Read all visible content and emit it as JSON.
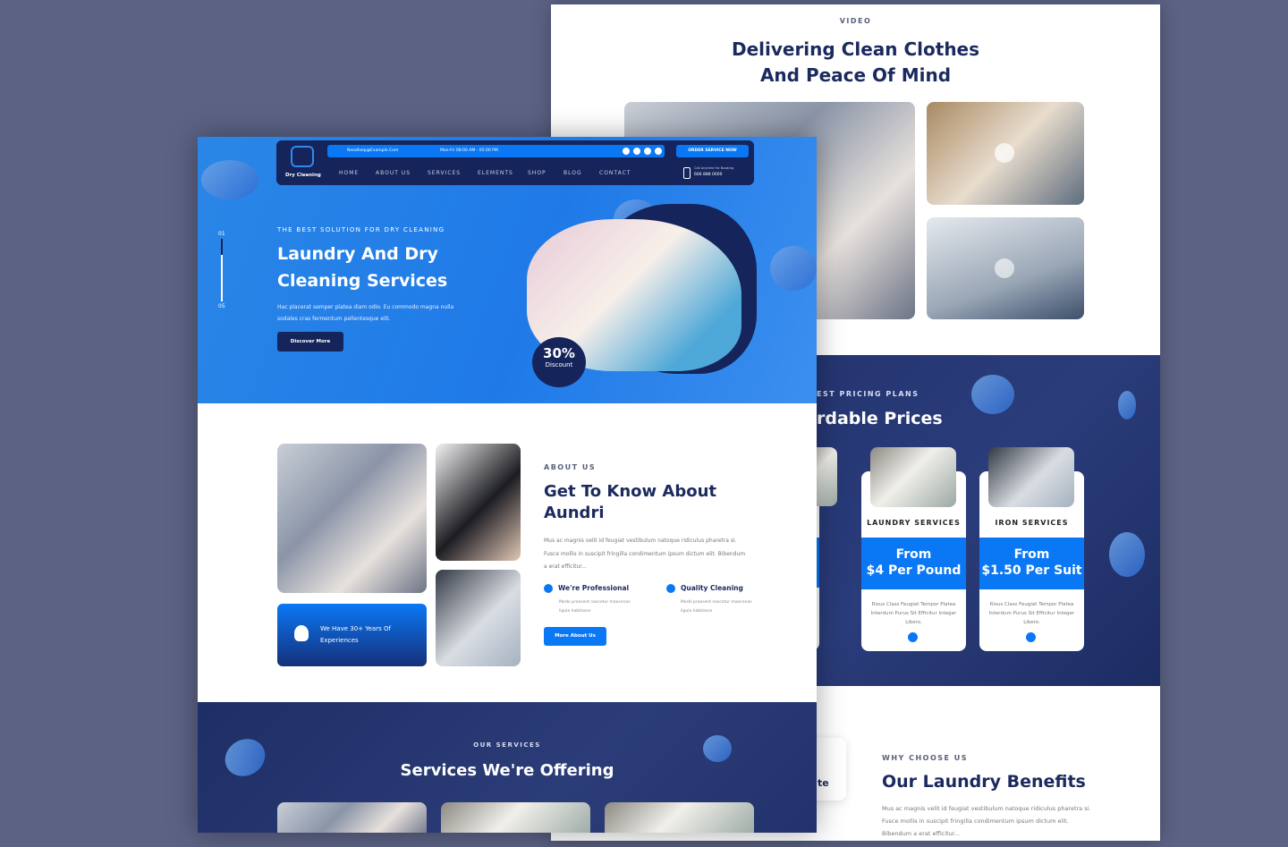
{
  "back": {
    "video": {
      "eyebrow": "VIDEO",
      "title_line1": "Delivering Clean Clothes",
      "title_line2": "And Peace Of Mind"
    },
    "pricing": {
      "eyebrow": "EST PRICING PLANS",
      "title": "rdable Prices",
      "cards": [
        {
          "name": "NG",
          "price_line1": "",
          "price_line2": "ess",
          "desc": "mpor s Sit ro."
        },
        {
          "name": "LAUNDRY SERVICES",
          "price_line1": "From",
          "price_line2": "$4 Per Pound",
          "desc": "Risus Class Feugiat Tempor Platea Interdum Purus Sit Efficitur Integer Libero."
        },
        {
          "name": "IRON SERVICES",
          "price_line1": "From",
          "price_line2": "$1.50 Per Suit",
          "desc": "Risus Class Feugiat Tempor Platea Interdum Purus Sit Efficitur Integer Libero."
        }
      ]
    },
    "why": {
      "eyebrow": "WHY CHOOSE US",
      "title": "Our Laundry Benefits",
      "text": "Mus ac magnis velit id feugiat vestibulum natoque ridiculus pharetra si. Fusce mollis in suscipit fringilla condimentum ipsum dictum elit. Bibendum a erat efficitur...",
      "card_fragment": "te"
    }
  },
  "front": {
    "header": {
      "logo": "Dry Cleaning",
      "email": "Needhelp@Example.Com",
      "hours": "Mon-Fri 08:00 AM - 05:00 PM",
      "order_button": "ORDER SERVICE NOW",
      "nav": [
        "HOME",
        "ABOUT US",
        "SERVICES",
        "ELEMENTS",
        "SHOP",
        "BLOG",
        "CONTACT"
      ],
      "call_label": "Call Anytime For Booking",
      "phone": "666 888 0000",
      "social_icons": [
        "facebook-icon",
        "twitter-icon",
        "linkedin-icon",
        "instagram-icon"
      ]
    },
    "hero": {
      "slide_start": "01",
      "slide_end": "05",
      "eyebrow": "THE BEST SOLUTION FOR DRY CLEANING",
      "title_line1": "Laundry And Dry",
      "title_line2": "Cleaning Services",
      "text_line1": "Hac placerat semper platea diam odio. Eu commodo magna nulla",
      "text_line2": "sodales cras fermentum pellentesque elit.",
      "button": "Discover More",
      "badge_value": "30%",
      "badge_label": "Discount"
    },
    "about": {
      "eyebrow": "ABOUT US",
      "title_line1": "Get To Know About",
      "title_line2": "Aundri",
      "text": "Mus ac magnis velit id feugiat vestibulum natoque ridiculus pharetra si. Fusce mollis in suscipit fringilla condimentum ipsum dictum elit. Bibendum a erat efficitur...",
      "features": [
        {
          "title": "We're Professional",
          "text": "Morbi praesent nascetur maecenas ligula habitasse"
        },
        {
          "title": "Quality Cleaning",
          "text": "Morbi praesent nascetur maecenas ligula habitasse"
        }
      ],
      "button": "More About Us",
      "experience": "We Have 30+ Years Of Experiences"
    },
    "services": {
      "eyebrow": "OUR SERVICES",
      "title": "Services We're Offering"
    }
  },
  "colors": {
    "background": "#5b6284",
    "navy": "#1b2a5e",
    "blue": "#0a78f5"
  }
}
